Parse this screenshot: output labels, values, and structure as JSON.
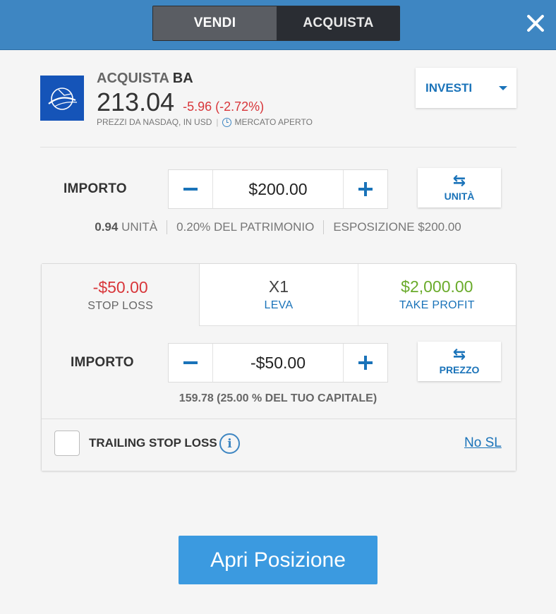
{
  "header": {
    "sell_label": "VENDI",
    "buy_label": "ACQUISTA",
    "close_icon": "close-icon"
  },
  "instrument": {
    "action": "ACQUISTA",
    "symbol": "BA",
    "price": "213.04",
    "change": "-5.96 (-2.72%)",
    "source": "PREZZI DA NASDAQ, IN USD",
    "separator": "|",
    "market_status": "MERCATO APERTO",
    "logo_icon": "boeing-logo-icon",
    "colors": {
      "logo_bg": "#1554b8",
      "negative": "#d8363a"
    }
  },
  "invest_dropdown": {
    "label": "INVESTI"
  },
  "amount": {
    "label": "IMPORTO",
    "value": "$200.00",
    "switch_label": "UNITÀ",
    "summary": {
      "units_value": "0.94",
      "units_label": "UNITÀ",
      "equity": "0.20% DEL PATRIMONIO",
      "exposure": "ESPOSIZIONE $200.00"
    }
  },
  "risk_tabs": {
    "stop_loss": {
      "value": "-$50.00",
      "label": "STOP LOSS"
    },
    "leverage": {
      "value": "X1",
      "label": "LEVA"
    },
    "take_profit": {
      "value": "$2,000.00",
      "label": "TAKE PROFIT"
    }
  },
  "stop_loss_panel": {
    "label": "IMPORTO",
    "value": "-$50.00",
    "switch_label": "PREZZO",
    "capital_text": "159.78 (25.00 % DEL TUO CAPITALE)",
    "trailing_label": "TRAILING STOP LOSS",
    "no_sl_link": "No SL"
  },
  "open_button": {
    "label": "Apri Posizione"
  },
  "theme": {
    "header_bg": "#3e86c2",
    "accent_blue": "#1a73b9",
    "take_profit_green": "#6aab2b",
    "open_button_bg": "#3b9ae0"
  }
}
